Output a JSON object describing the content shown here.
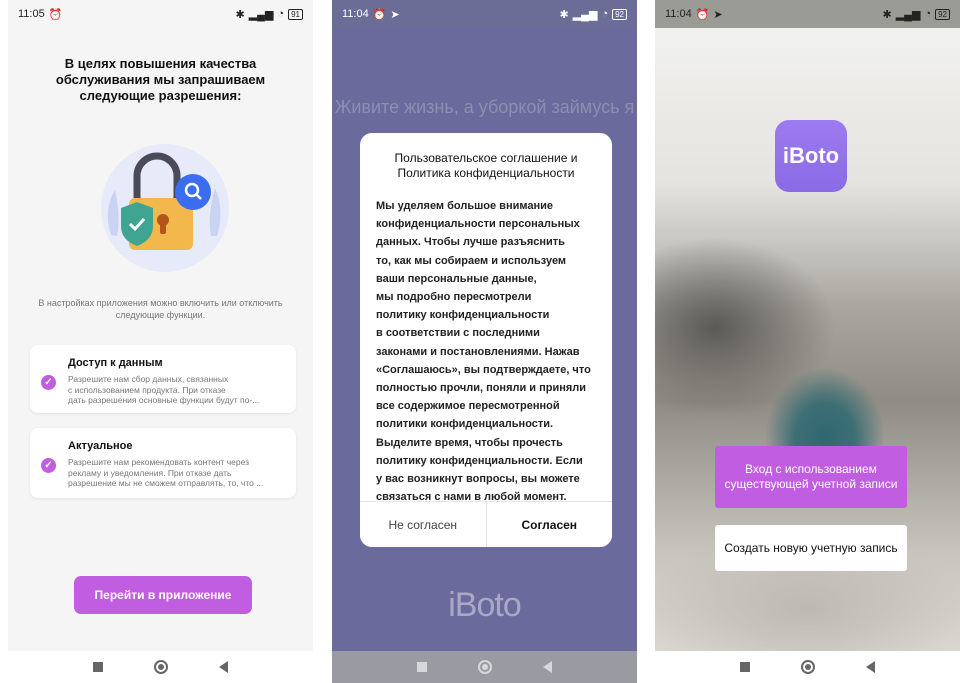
{
  "screens": [
    {
      "status": {
        "time": "11:05",
        "battery": "91"
      },
      "title": "В целях повышения качества обслуживания мы запрашиваем следующие разрешения:",
      "note": "В настройках приложения можно включить или отключить следующие функции.",
      "permissions": [
        {
          "title": "Доступ к данным",
          "lines": [
            "Разрешите нам сбор данных, связанных",
            "с использованием продукта. При отказе",
            "дать разрешения основные функции будут по-..."
          ]
        },
        {
          "title": "Актуальное",
          "lines": [
            "Разрешите нам рекомендовать контент через",
            "рекламу и уведомления. При отказе дать",
            "разрешение мы не сможем отправлять, то, что ..."
          ]
        }
      ],
      "button": "Перейти в приложение"
    },
    {
      "status": {
        "time": "11:04",
        "battery": "92"
      },
      "background_text": "Живите жизнь, а уборкой займусь я",
      "dialog": {
        "title": "Пользовательское соглашение и Политика конфиденциальности",
        "lines": [
          "Мы уделяем большое внимание",
          "конфиденциальности персональных",
          "данных. Чтобы лучше разъяснить",
          "то, как мы собираем и используем",
          "ваши персональные данные,",
          "мы подробно пересмотрели",
          "политику конфиденциальности",
          "в соответствии с последними",
          "законами и постановлениями. Нажав",
          "«Соглашаюсь», вы подтверждаете, что",
          "полностью прочли, поняли и приняли",
          "все содержимое пересмотренной",
          "политики конфиденциальности.",
          "Выделите время, чтобы прочесть",
          "политику конфиденциальности. Если",
          "у вас возникнут вопросы, вы можете",
          "связаться с нами в любой момент."
        ],
        "disagree": "Не согласен",
        "agree": "Согласен"
      },
      "logo": "iBoto"
    },
    {
      "status": {
        "time": "11:04",
        "battery": "92"
      },
      "logo": "iBoto",
      "login_button": "Вход с использованием существующей учетной записи",
      "create_button": "Создать новую учетную запись"
    }
  ],
  "colors": {
    "accent": "#c15de0",
    "logo_tile": "#9d7bf0",
    "dialog_backdrop": "#6a6b9c"
  },
  "icons": [
    "alarm-icon",
    "instagram-icon",
    "telegram-icon",
    "bluetooth-icon",
    "signal-icon",
    "wifi-icon",
    "battery-icon",
    "checkmark-icon",
    "lock-search-illustration",
    "nav-recents-icon",
    "nav-home-icon",
    "nav-back-icon"
  ]
}
